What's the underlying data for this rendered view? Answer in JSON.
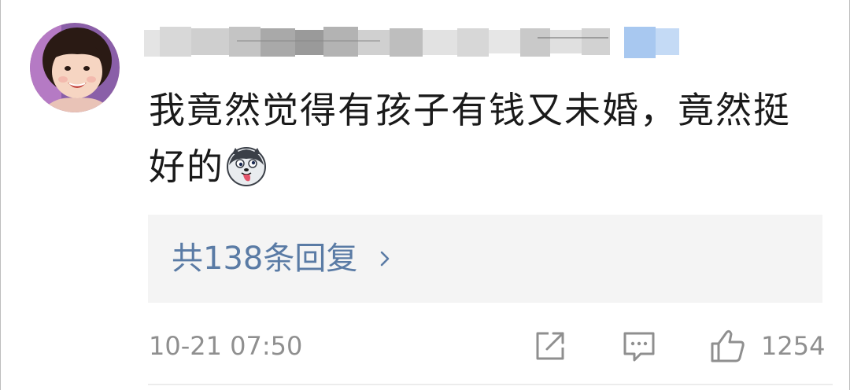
{
  "comment": {
    "username": "",
    "text": "我竟然觉得有孩子有钱又未婚，竟然挺好的",
    "emoji": "husky-tongue-emoji",
    "replies_label": "共138条回复",
    "replies_chevron": "chevron-right-icon",
    "timestamp": "10-21 07:50",
    "like_count": "1254"
  },
  "actions": {
    "share_icon": "share-icon",
    "reply_icon": "comment-icon",
    "like_icon": "thumbs-up-icon"
  },
  "colors": {
    "link": "#5a7ba5",
    "meta": "#8f8f8f",
    "text": "#1a1a1a",
    "reply_bg": "#f4f4f4",
    "blur_accent": "#a8c8f0"
  }
}
